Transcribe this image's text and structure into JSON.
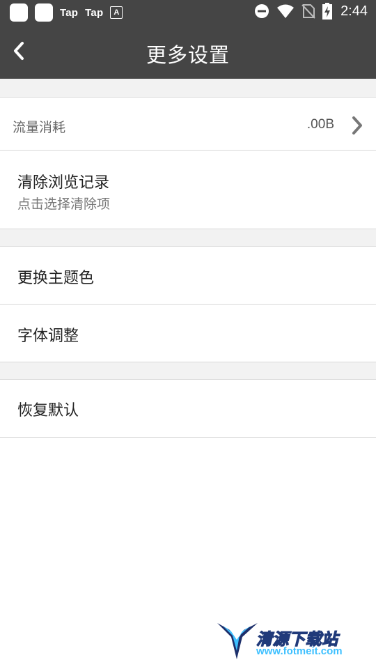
{
  "status_bar": {
    "notif_1": "Tap",
    "notif_2": "Tap",
    "notif_3": "A",
    "time": "2:44",
    "icons": [
      "app-icon",
      "app-icon",
      "taptap-icon",
      "taptap-icon",
      "font-icon",
      "do-not-disturb-icon",
      "wifi-icon",
      "no-sim-icon",
      "battery-charging-icon"
    ]
  },
  "header": {
    "title": "更多设置",
    "back_icon": "chevron-left-icon"
  },
  "settings": {
    "traffic": {
      "label": "流量消耗",
      "value": ".00B"
    },
    "clear_history": {
      "label": "清除浏览记录",
      "sub": "点击选择清除项"
    },
    "theme_color": {
      "label": "更换主题色"
    },
    "font_adjust": {
      "label": "字体调整"
    },
    "restore_default": {
      "label": "恢复默认"
    }
  },
  "watermark": {
    "title": "清源下载站",
    "url": "www.fotmeit.com"
  },
  "colors": {
    "app_bar": "#454545",
    "section_gap": "#f2f2f2",
    "divider": "#d8d8d8"
  }
}
